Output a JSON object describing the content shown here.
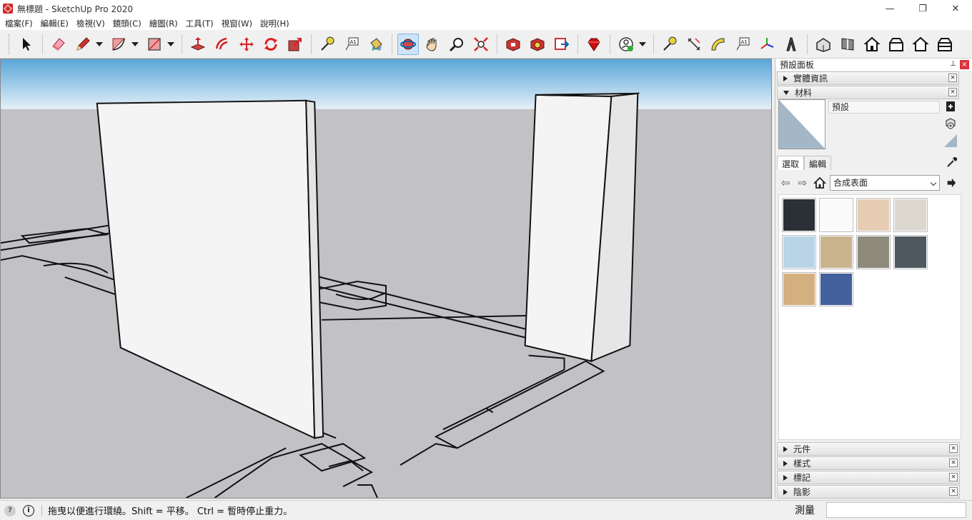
{
  "window": {
    "title": "無標題 - SketchUp Pro 2020",
    "minimize": "—",
    "restore": "❐",
    "close": "✕"
  },
  "menu": [
    "檔案(F)",
    "編輯(E)",
    "檢視(V)",
    "鏡頭(C)",
    "繪圖(R)",
    "工具(T)",
    "視窗(W)",
    "說明(H)"
  ],
  "toolbar_icons": [
    "select-icon",
    "eraser-icon",
    "pencil-icon",
    "arc-icon",
    "rectangle-icon",
    "push-pull-icon",
    "offset-icon",
    "move-icon",
    "rotate-icon",
    "scale-icon",
    "tape-measure-icon",
    "text-icon",
    "paint-bucket-icon",
    "orbit-icon",
    "pan-icon",
    "zoom-icon",
    "zoom-extents-icon",
    "3d-warehouse-icon",
    "extension-warehouse-icon",
    "layout-send-icon",
    "ruby-console-icon",
    "account-icon",
    "tape-measure-2-icon",
    "dimension-icon",
    "protractor-icon",
    "text-2-icon",
    "axes-icon",
    "3d-text-icon",
    "iso-view-icon",
    "top-view-icon",
    "front-view-icon",
    "right-view-icon",
    "back-view-icon",
    "left-view-icon"
  ],
  "tray": {
    "title": "預設面板",
    "pin": "📌",
    "close": "×",
    "panels_top": [
      {
        "label": "實體資訊",
        "expanded": false
      },
      {
        "label": "材料",
        "expanded": true
      }
    ],
    "material": {
      "name": "預設",
      "tabs": [
        "選取",
        "編輯"
      ],
      "library": "合成表面",
      "swatches": [
        {
          "color": "#2b2f36"
        },
        {
          "color": "#fafafa"
        },
        {
          "color": "#e6cdb4"
        },
        {
          "color": "#dcd8d0"
        },
        {
          "color": "#b8d4e6"
        },
        {
          "color": "#c9b48d"
        },
        {
          "color": "#8e8a7c"
        },
        {
          "color": "#4d5860"
        },
        {
          "color": "#d4b080"
        },
        {
          "color": "#44609c"
        }
      ]
    },
    "panels_bottom": [
      {
        "label": "元件"
      },
      {
        "label": "樣式"
      },
      {
        "label": "標記"
      },
      {
        "label": "陰影"
      }
    ]
  },
  "status": {
    "hint": "拖曳以便進行環繞。Shift = 平移。 Ctrl = 暫時停止重力。",
    "measure_label": "測量",
    "measure_value": ""
  },
  "colors": {
    "sky_top": "#5aa6d8",
    "sky_bottom": "#e4f0f8",
    "ground": "#c2c2c6",
    "accent_close": "#d9343f"
  }
}
